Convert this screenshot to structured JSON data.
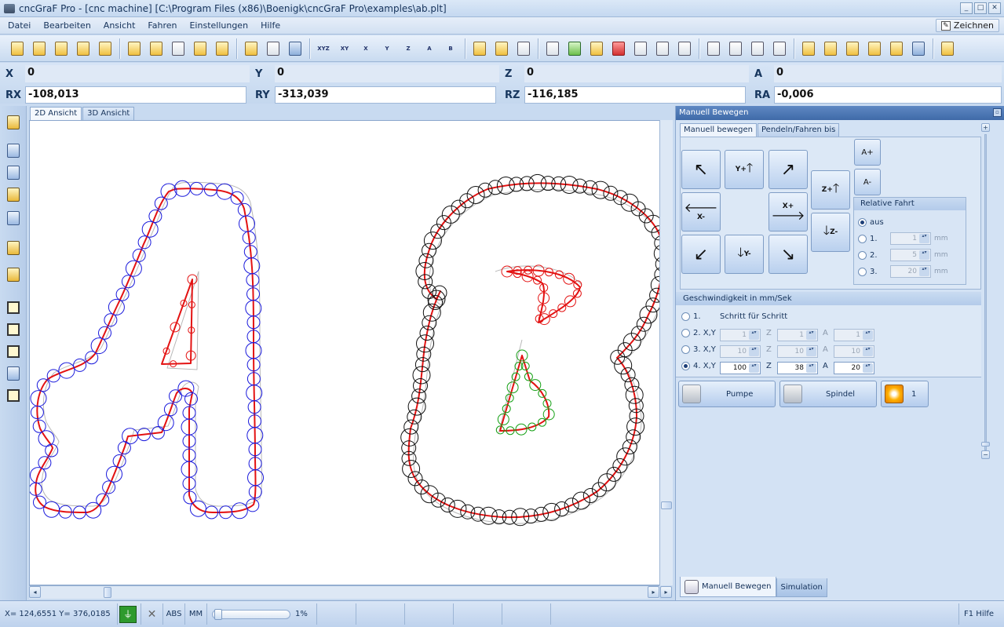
{
  "window": {
    "title": "cncGraF Pro - [cnc machine] [C:\\Program Files (x86)\\Boenigk\\cncGraF Pro\\examples\\ab.plt]",
    "min": "_",
    "max": "□",
    "close": "✕"
  },
  "menu": {
    "items": [
      "Datei",
      "Bearbeiten",
      "Ansicht",
      "Fahren",
      "Einstellungen",
      "Hilfe"
    ],
    "right_label": "Zeichnen"
  },
  "axis_buttons": [
    "XYZ",
    "XY",
    "X",
    "Y",
    "Z",
    "A",
    "B"
  ],
  "coords": {
    "row1": [
      {
        "label": "X",
        "value": "0"
      },
      {
        "label": "Y",
        "value": "0"
      },
      {
        "label": "Z",
        "value": "0"
      },
      {
        "label": "A",
        "value": "0"
      }
    ],
    "row2": [
      {
        "label": "RX",
        "value": "-108,013"
      },
      {
        "label": "RY",
        "value": "-313,039"
      },
      {
        "label": "RZ",
        "value": "-116,185"
      },
      {
        "label": "RA",
        "value": "-0,006"
      }
    ]
  },
  "view_tabs": [
    "2D Ansicht",
    "3D Ansicht"
  ],
  "panel": {
    "title": "Manuell Bewegen",
    "pin": "▫",
    "tabs": [
      "Manuell bewegen",
      "Pendeln/Fahren bis"
    ],
    "move": {
      "ul": "↖",
      "yplus": "Y+",
      "ur": "↗",
      "xminus": "X-",
      "xplus": "X+",
      "dl": "↙",
      "yminus": "Y-",
      "dr": "↘",
      "zplus": "Z+",
      "zminus": "Z-",
      "aplus": "A+",
      "aminus": "A-"
    },
    "relative": {
      "title": "Relative Fahrt",
      "aus": "aus",
      "rows": [
        {
          "label": "1.",
          "value": "1",
          "unit": "mm"
        },
        {
          "label": "2.",
          "value": "5",
          "unit": "mm"
        },
        {
          "label": "3.",
          "value": "20",
          "unit": "mm"
        }
      ]
    },
    "speed": {
      "title": "Geschwindigkeit in mm/Sek",
      "rows": [
        {
          "label": "1.",
          "text": "Schritt für Schritt"
        },
        {
          "label": "2. X,Y",
          "xy": "1",
          "zl": "Z",
          "z": "1",
          "al": "A",
          "a": "1"
        },
        {
          "label": "3. X,Y",
          "xy": "10",
          "zl": "Z",
          "z": "10",
          "al": "A",
          "a": "10"
        },
        {
          "label": "4. X,Y",
          "xy": "100",
          "zl": "Z",
          "z": "38",
          "al": "A",
          "a": "20"
        }
      ]
    },
    "buttons": {
      "pump": "Pumpe",
      "spindle": "Spindel",
      "laser": "1"
    },
    "bottom_tabs": [
      "Manuell Bewegen",
      "Simulation"
    ]
  },
  "status": {
    "coords": "X= 124,6551 Y= 376,0185",
    "abs": "ABS",
    "mm": "MM",
    "zoom": "1%",
    "help": "F1 Hilfe"
  },
  "colors": {
    "path": "#e31212",
    "a_circles": "#1a1adc",
    "b_circles": "#111111",
    "inner_circles": "#14a014",
    "outline": "#b8b8b8"
  }
}
